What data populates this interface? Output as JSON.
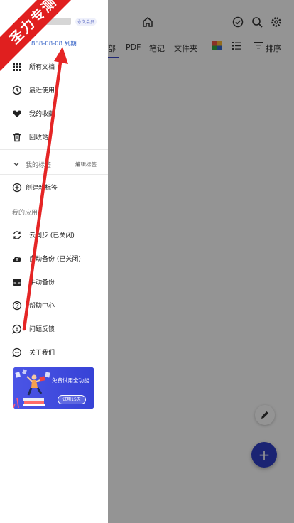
{
  "drawer": {
    "account": {
      "vip_badge": "永久会员",
      "expiry": "888-08-08 到期"
    },
    "menu": [
      {
        "label": "所有文档",
        "icon": "grid-icon"
      },
      {
        "label": "最近使用",
        "icon": "clock-icon"
      },
      {
        "label": "我的收藏",
        "icon": "heart-icon"
      },
      {
        "label": "回收站",
        "icon": "trash-icon"
      }
    ],
    "tags": {
      "label": "我的标签",
      "edit": "编辑标签",
      "create": "创建新标签"
    },
    "apps_title": "我的应用",
    "apps": [
      {
        "label": "云同步 (已关闭)",
        "icon": "sync-icon"
      },
      {
        "label": "自动备份 (已关闭)",
        "icon": "cloud-upload-icon"
      },
      {
        "label": "手动备份",
        "icon": "inbox-icon"
      },
      {
        "label": "帮助中心",
        "icon": "help-icon"
      },
      {
        "label": "问题反馈",
        "icon": "feedback-icon"
      },
      {
        "label": "关于我们",
        "icon": "chat-icon"
      }
    ],
    "promo": {
      "title": "免费试用全功能",
      "button": "试用15天"
    }
  },
  "background": {
    "tabs": [
      "部",
      "PDF",
      "笔记",
      "文件夹"
    ],
    "sort_label": "排序"
  },
  "watermark": "圣力专测",
  "colors": {
    "accent": "#2f3fc6",
    "watermark": "#e01f1f",
    "expiry": "#3a66c8"
  }
}
